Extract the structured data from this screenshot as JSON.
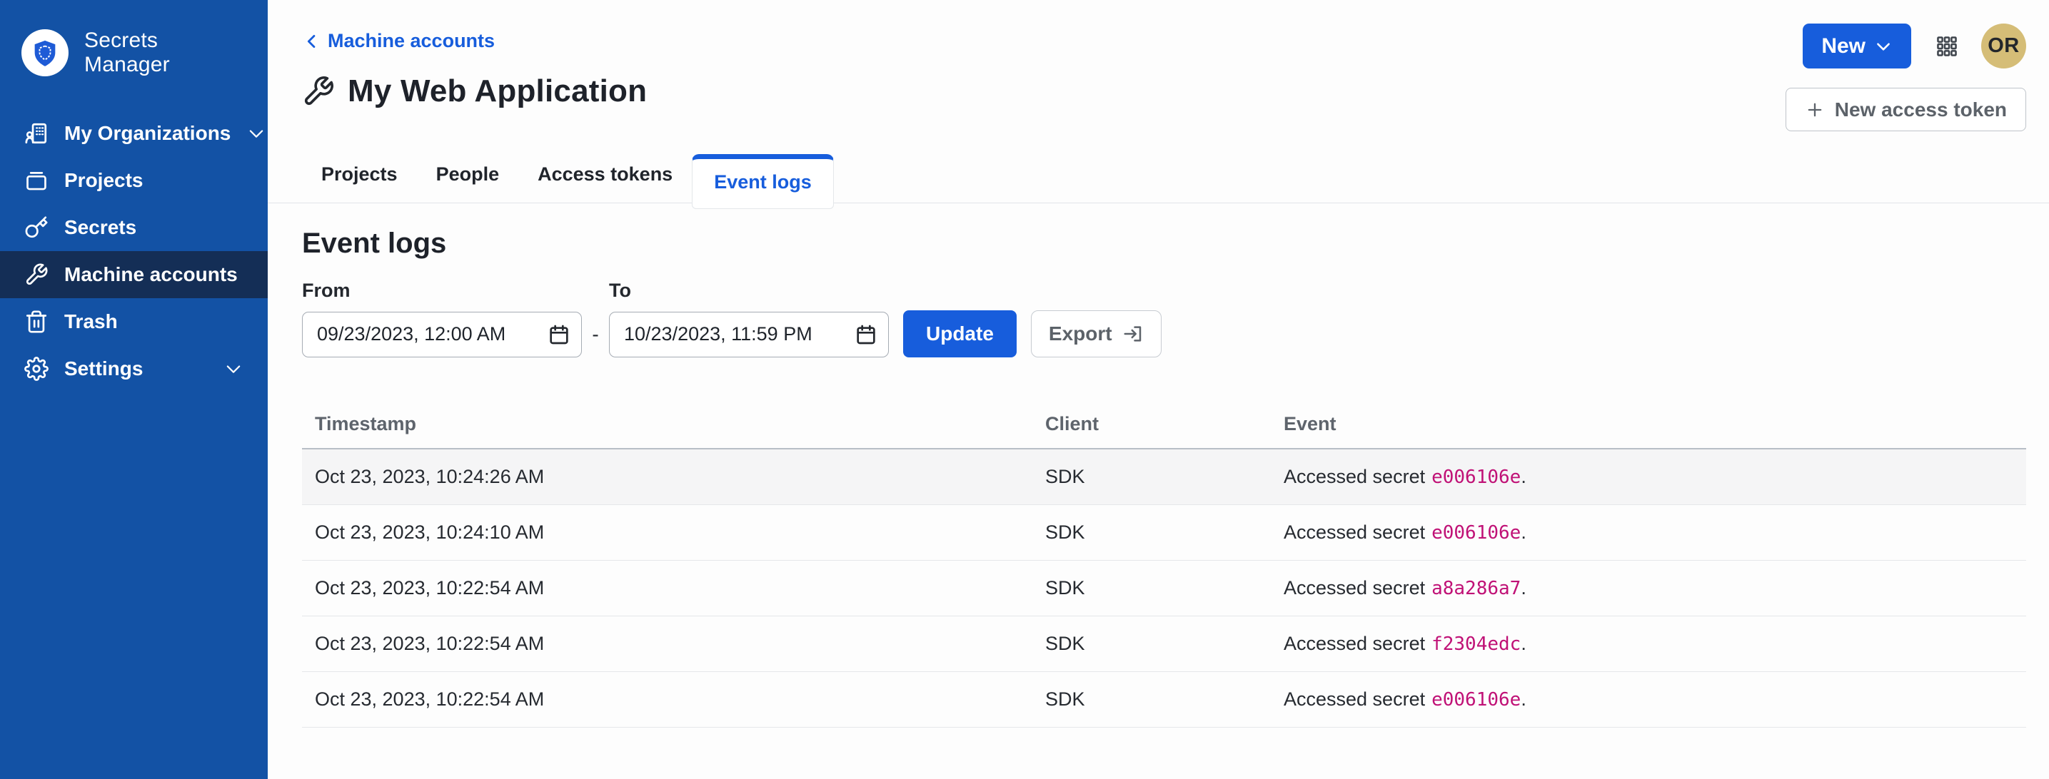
{
  "colors": {
    "accent": "#175DDC",
    "sidebar_bg": "#1352A5",
    "sidebar_active_bg": "#142E56",
    "code_pink": "#C01176",
    "avatar_bg": "#D5BD77",
    "row_highlight": "#F5F5F6"
  },
  "sidebar": {
    "brand": "Secrets Manager",
    "logo_icon": "bitwarden-shield-icon",
    "items": [
      {
        "label": "My Organizations",
        "icon": "organization-icon",
        "chevron": true,
        "active": false
      },
      {
        "label": "Projects",
        "icon": "projects-icon",
        "chevron": false,
        "active": false
      },
      {
        "label": "Secrets",
        "icon": "key-icon",
        "chevron": false,
        "active": false
      },
      {
        "label": "Machine accounts",
        "icon": "wrench-icon",
        "chevron": false,
        "active": true
      },
      {
        "label": "Trash",
        "icon": "trash-icon",
        "chevron": false,
        "active": false
      },
      {
        "label": "Settings",
        "icon": "gear-icon",
        "chevron": true,
        "active": false
      }
    ]
  },
  "topbar": {
    "new_button_label": "New",
    "app_switcher_icon": "grid-icon",
    "avatar_initials": "OR"
  },
  "page": {
    "breadcrumb": "Machine accounts",
    "title": "My Web Application",
    "title_icon": "wrench-icon",
    "new_access_token_label": "New access token"
  },
  "tabs": [
    {
      "label": "Projects",
      "active": false
    },
    {
      "label": "People",
      "active": false
    },
    {
      "label": "Access tokens",
      "active": false
    },
    {
      "label": "Event logs",
      "active": true
    }
  ],
  "event_logs": {
    "heading": "Event logs",
    "filter": {
      "from_label": "From",
      "from_value": "09/23/2023, 12:00 AM",
      "to_label": "To",
      "to_value": "10/23/2023, 11:59 PM",
      "range_separator": "-",
      "update_label": "Update",
      "export_label": "Export"
    },
    "table": {
      "headers": [
        "Timestamp",
        "Client",
        "Event"
      ],
      "rows": [
        {
          "timestamp": "Oct 23, 2023, 10:24:26 AM",
          "client": "SDK",
          "event_text": "Accessed secret",
          "secret_id": "e006106e",
          "event_suffix": "."
        },
        {
          "timestamp": "Oct 23, 2023, 10:24:10 AM",
          "client": "SDK",
          "event_text": "Accessed secret",
          "secret_id": "e006106e",
          "event_suffix": "."
        },
        {
          "timestamp": "Oct 23, 2023, 10:22:54 AM",
          "client": "SDK",
          "event_text": "Accessed secret",
          "secret_id": "a8a286a7",
          "event_suffix": "."
        },
        {
          "timestamp": "Oct 23, 2023, 10:22:54 AM",
          "client": "SDK",
          "event_text": "Accessed secret",
          "secret_id": "f2304edc",
          "event_suffix": "."
        },
        {
          "timestamp": "Oct 23, 2023, 10:22:54 AM",
          "client": "SDK",
          "event_text": "Accessed secret",
          "secret_id": "e006106e",
          "event_suffix": "."
        }
      ]
    }
  }
}
